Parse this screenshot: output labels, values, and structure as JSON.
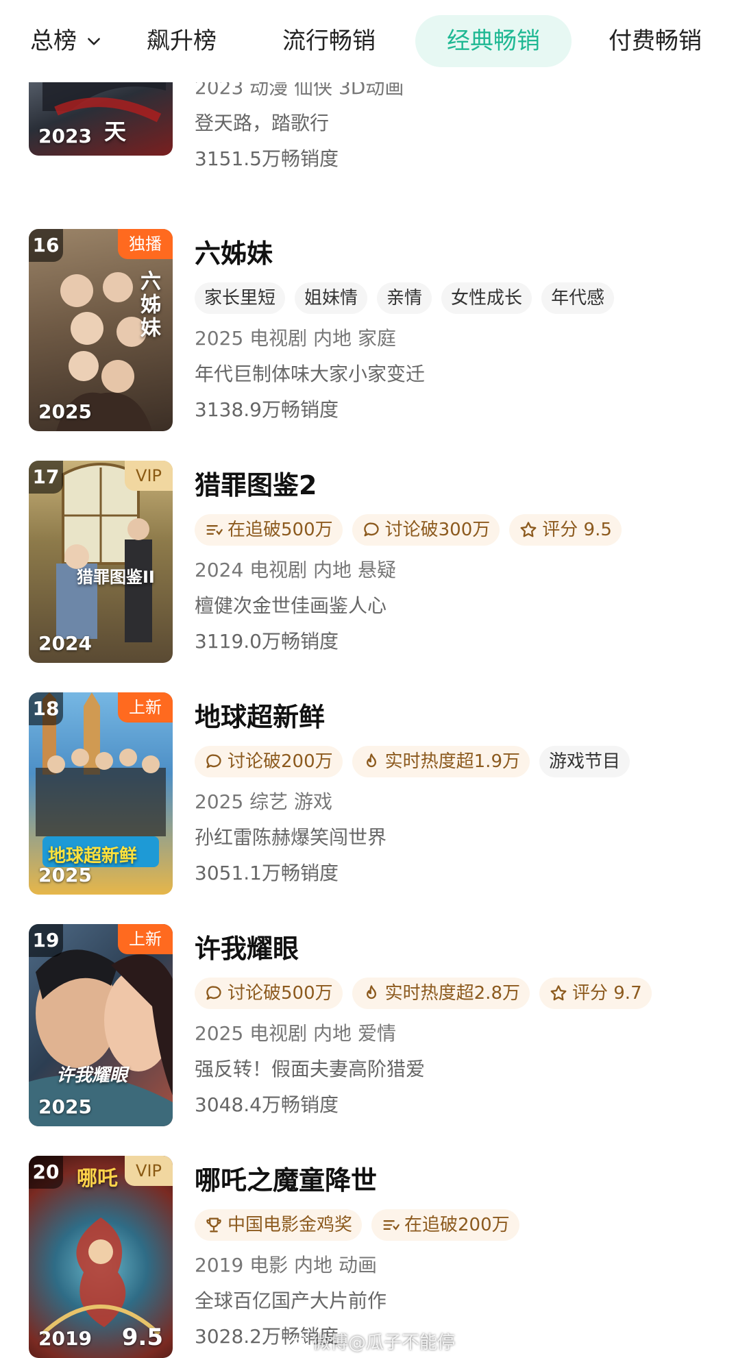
{
  "tabs": {
    "items": [
      {
        "label": "总榜",
        "active": false,
        "dropdown": true
      },
      {
        "label": "飙升榜",
        "active": false
      },
      {
        "label": "流行畅销",
        "active": false
      },
      {
        "label": "经典畅销",
        "active": true
      },
      {
        "label": "付费畅销",
        "active": false
      }
    ]
  },
  "items": [
    {
      "rank": "",
      "badge": "",
      "poster_year": "2023",
      "poster_text": "天",
      "title": "",
      "tags": [],
      "meta": "2023 动漫 仙侠 3D动画",
      "desc": "登天路，踏歌行",
      "sales": "3151.5万畅销度"
    },
    {
      "rank": "16",
      "badge": "独播",
      "poster_year": "2025",
      "poster_text": "六姊妹",
      "title": "六姊妹",
      "tags": [
        {
          "label": "家长里短",
          "icon": ""
        },
        {
          "label": "姐妹情",
          "icon": ""
        },
        {
          "label": "亲情",
          "icon": ""
        },
        {
          "label": "女性成长",
          "icon": ""
        },
        {
          "label": "年代感",
          "icon": ""
        }
      ],
      "meta": "2025 电视剧 内地 家庭",
      "desc": "年代巨制体味大家小家变迁",
      "sales": "3138.9万畅销度"
    },
    {
      "rank": "17",
      "badge": "VIP",
      "poster_year": "2024",
      "poster_text": "猎罪图鉴II",
      "title": "猎罪图鉴2",
      "tags": [
        {
          "label": "在追破500万",
          "icon": "list-icon"
        },
        {
          "label": "讨论破300万",
          "icon": "comment-icon"
        },
        {
          "label": "评分 9.5",
          "icon": "star-icon"
        }
      ],
      "meta": "2024 电视剧 内地 悬疑",
      "desc": "檀健次金世佳画鉴人心",
      "sales": "3119.0万畅销度"
    },
    {
      "rank": "18",
      "badge": "上新",
      "poster_year": "2025",
      "poster_text": "地球超新鲜",
      "title": "地球超新鲜",
      "tags": [
        {
          "label": "讨论破200万",
          "icon": "comment-icon"
        },
        {
          "label": "实时热度超1.9万",
          "icon": "flame-icon"
        },
        {
          "label": "游戏节目",
          "icon": ""
        }
      ],
      "meta": "2025 综艺 游戏",
      "desc": "孙红雷陈赫爆笑闯世界",
      "sales": "3051.1万畅销度"
    },
    {
      "rank": "19",
      "badge": "上新",
      "poster_year": "2025",
      "poster_text": "许我耀眼",
      "title": "许我耀眼",
      "tags": [
        {
          "label": "讨论破500万",
          "icon": "comment-icon"
        },
        {
          "label": "实时热度超2.8万",
          "icon": "flame-icon"
        },
        {
          "label": "评分 9.7",
          "icon": "star-icon"
        }
      ],
      "meta": "2025 电视剧 内地 爱情",
      "desc": "强反转！假面夫妻高阶猎爱",
      "sales": "3048.4万畅销度"
    },
    {
      "rank": "20",
      "badge": "VIP",
      "poster_year": "2019",
      "poster_score": "9.5",
      "poster_text": "哪吒",
      "title": "哪吒之魔童降世",
      "tags": [
        {
          "label": "中国电影金鸡奖",
          "icon": "trophy-icon"
        },
        {
          "label": "在追破200万",
          "icon": "list-icon"
        }
      ],
      "meta": "2019 电影 内地 动画",
      "desc": "全球百亿国产大片前作",
      "sales": "3028.2万畅销度"
    }
  ],
  "watermark": "微博@瓜子不能停",
  "colors": {
    "accent": "#1fb893",
    "tab_active_bg": "#e7f8f3",
    "badge_orange": "#ff6a1f",
    "badge_vip": "#f1d7a0",
    "hot_tag_bg": "#fdf4ea",
    "hot_tag_text": "#8c5a1e"
  }
}
